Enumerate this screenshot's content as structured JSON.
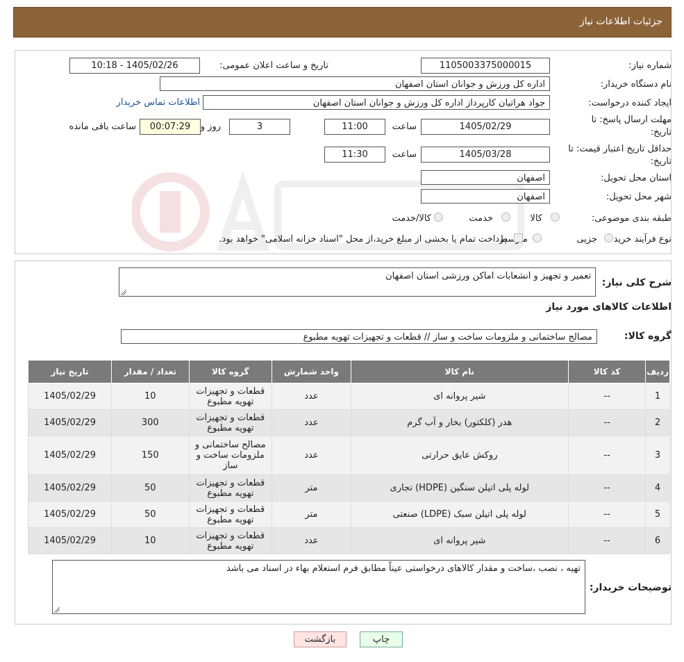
{
  "header": {
    "title": "جزئیات اطلاعات نیاز"
  },
  "form": {
    "need_number_label": "شماره نیاز:",
    "need_number": "1105003375000015",
    "announce_label": "تاریخ و ساعت اعلان عمومی:",
    "announce_value": "1405/02/26 - 10:18",
    "buyer_org_label": "نام دستگاه خریدار:",
    "buyer_org": "اداره کل ورزش و جوانان استان اصفهان",
    "requester_label": "ایجاد کننده درخواست:",
    "requester": "جواد هراتیان کارپرداز اداره کل ورزش و جوانان استان اصفهان",
    "contact_link": "اطلاعات تماس خریدار",
    "deadline_label_1": "مهلت ارسال پاسخ: تا",
    "deadline_label_2": "تاریخ:",
    "deadline_date": "1405/02/29",
    "time_label": "ساعت",
    "deadline_time": "11:00",
    "days_value": "3",
    "days_label": "روز و",
    "remaining_value": "00:07:29",
    "remaining_label": "ساعت باقی مانده",
    "validity_label_1": "حداقل تاریخ اعتبار قیمت: تا",
    "validity_label_2": "تاریخ:",
    "validity_date": "1405/03/28",
    "validity_time": "11:30",
    "province_label": "استان محل تحویل:",
    "province": "اصفهان",
    "city_label": "شهر محل تحویل:",
    "city": "اصفهان",
    "category_label": "طبقه بندی موضوعی:",
    "category_options": [
      "کالا",
      "خدمت",
      "کالا/خدمت"
    ],
    "process_label": "نوع فرآیند خرید :",
    "process_options": [
      "جزیی",
      "متوسط"
    ],
    "process_note": "پرداخت تمام یا بخشی از مبلغ خرید،از محل \"اسناد خزانه اسلامی\" خواهد بود."
  },
  "details": {
    "summary_label": "شرح کلی نیاز:",
    "summary": "تعمیر و تجهیز و انشعابات اماکن ورزشی استان اصفهان",
    "goods_title": "اطلاعات کالاهای مورد نیاز",
    "group_label": "گروه کالا:",
    "group_value": "مصالح ساختمانی و ملزومات ساخت و ساز //  قطعات و تجهیزات تهویه مطبوع",
    "columns": [
      "ردیف",
      "کد کالا",
      "نام کالا",
      "واحد شمارش",
      "گروه کالا",
      "تعداد / مقدار",
      "تاریخ نیاز"
    ],
    "rows": [
      {
        "idx": "1",
        "code": "--",
        "name": "شیر پروانه ای",
        "unit": "عدد",
        "group": "قطعات و تجهیزات تهویه مطبوع",
        "qty": "10",
        "date": "1405/02/29"
      },
      {
        "idx": "2",
        "code": "--",
        "name": "هدر (کلکتور) بخار و آب گرم",
        "unit": "عدد",
        "group": "قطعات و تجهیزات تهویه مطبوع",
        "qty": "300",
        "date": "1405/02/29"
      },
      {
        "idx": "3",
        "code": "--",
        "name": "روکش عایق حرارتی",
        "unit": "عدد",
        "group": "مصالح ساختمانی و ملزومات ساخت و ساز",
        "qty": "150",
        "date": "1405/02/29"
      },
      {
        "idx": "4",
        "code": "--",
        "name": "لوله پلی اتیلن سنگین (HDPE) تجاری",
        "unit": "متر",
        "group": "قطعات و تجهیزات تهویه مطبوع",
        "qty": "50",
        "date": "1405/02/29"
      },
      {
        "idx": "5",
        "code": "--",
        "name": "لوله پلی اتیلن سبک (LDPE) صنعتی",
        "unit": "متر",
        "group": "قطعات و تجهیزات تهویه مطبوع",
        "qty": "50",
        "date": "1405/02/29"
      },
      {
        "idx": "6",
        "code": "--",
        "name": "شیر پروانه ای",
        "unit": "عدد",
        "group": "قطعات و تجهیزات تهویه مطبوع",
        "qty": "10",
        "date": "1405/02/29"
      }
    ],
    "notes_label": "توضیحات خریدار:",
    "notes": "تهیه ، نصب ،ساخت  و مقدار کالاهای درخواستی عیناً مطابق فرم استعلام بهاء در اسناد می باشد"
  },
  "buttons": {
    "print": "چاپ",
    "back": "بازگشت"
  },
  "colors": {
    "header_bg": "#8c6239",
    "table_header_bg": "#7a7a7a",
    "link": "#1a53a0",
    "remaining_bg": "#ffffe0"
  }
}
